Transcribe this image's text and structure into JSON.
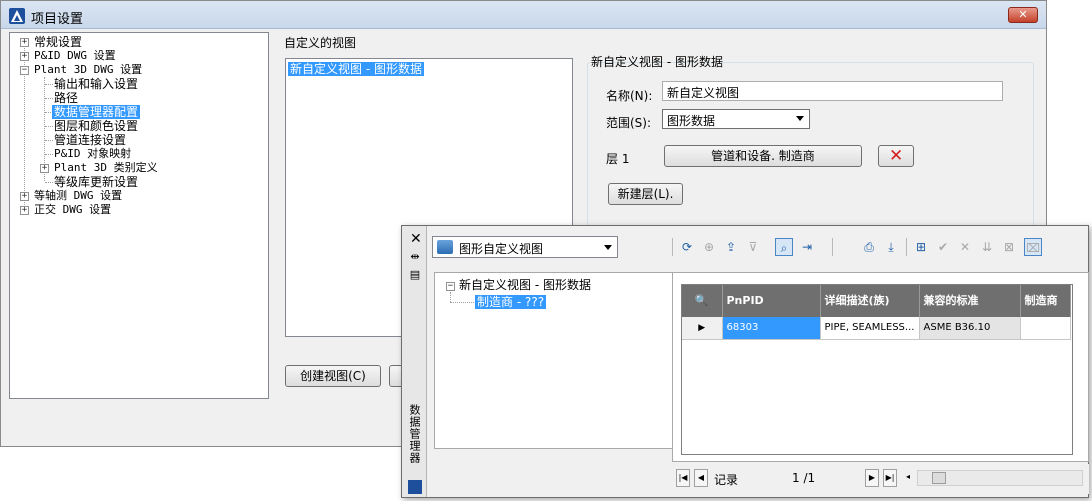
{
  "window": {
    "title": "项目设置",
    "close_label": "✕"
  },
  "tree": {
    "items": [
      {
        "label": "常规设置",
        "expander": "+"
      },
      {
        "label": "P&ID DWG 设置",
        "expander": "+"
      },
      {
        "label": "Plant 3D DWG 设置",
        "expander": "−"
      },
      {
        "label": "输出和输入设置"
      },
      {
        "label": "路径"
      },
      {
        "label": "数据管理器配置",
        "selected": true
      },
      {
        "label": "图层和颜色设置"
      },
      {
        "label": "管道连接设置"
      },
      {
        "label": "P&ID 对象映射"
      },
      {
        "label": "Plant 3D 类别定义",
        "expander": "+"
      },
      {
        "label": "等级库更新设置"
      },
      {
        "label": "等轴测 DWG 设置",
        "expander": "+"
      },
      {
        "label": "正交 DWG 设置",
        "expander": "+"
      }
    ]
  },
  "custom_views": {
    "group_label": "自定义的视图",
    "items": [
      "新自定义视图 - 图形数据"
    ],
    "create_button": "创建视图(C)"
  },
  "view_editor": {
    "title": "新自定义视图 - 图形数据",
    "name_label": "名称(N):",
    "name_value": "新自定义视图",
    "scope_label": "范围(S):",
    "scope_value": "图形数据",
    "layer_label": "层 1",
    "layer_button": "管道和设备. 制造商",
    "new_layer_button": "新建层(L)."
  },
  "palette": {
    "close": "✕",
    "side_title": "数据管理器",
    "combo_value": "图形自定义视图",
    "tree": {
      "root": "新自定义视图 - 图形数据",
      "child": "制造商 - ???"
    },
    "grid": {
      "columns": [
        "PnPID",
        "详细描述(族)",
        "兼容的标准",
        "制造商"
      ],
      "rows": [
        {
          "marker": "▶",
          "cells": [
            "68303",
            "PIPE, SEAMLESS...",
            "ASME B36.10",
            ""
          ]
        }
      ]
    },
    "nav": {
      "record_label": "记录",
      "position": "1 /1"
    }
  }
}
